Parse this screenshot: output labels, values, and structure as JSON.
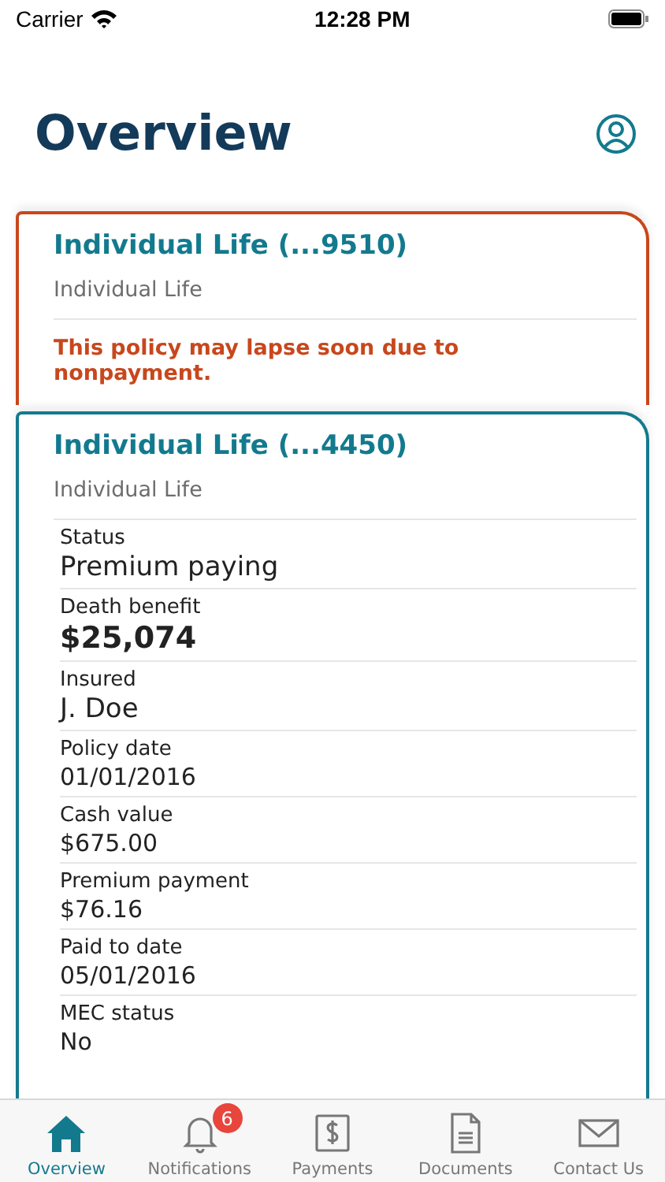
{
  "status_bar": {
    "carrier": "Carrier",
    "time": "12:28 PM"
  },
  "header": {
    "title": "Overview"
  },
  "policies": [
    {
      "title": "Individual Life (...9510)",
      "subtitle": "Individual Life",
      "alert": true,
      "warning": "This policy may lapse soon due to nonpayment."
    },
    {
      "title": "Individual Life (...4450)",
      "subtitle": "Individual Life",
      "alert": false,
      "fields": [
        {
          "label": "Status",
          "value": "Premium paying",
          "kind": "large"
        },
        {
          "label": "Death benefit",
          "value": "$25,074",
          "kind": "bold"
        },
        {
          "label": "Insured",
          "value": "J. Doe",
          "kind": "large"
        },
        {
          "label": "Policy date",
          "value": "01/01/2016",
          "kind": "plain"
        },
        {
          "label": "Cash value",
          "value": "$675.00",
          "kind": "plain"
        },
        {
          "label": "Premium payment",
          "value": "$76.16",
          "kind": "plain"
        },
        {
          "label": "Paid to date",
          "value": "05/01/2016",
          "kind": "plain"
        },
        {
          "label": "MEC status",
          "value": "No",
          "kind": "plain"
        }
      ]
    }
  ],
  "tabs": [
    {
      "label": "Overview",
      "selected": true
    },
    {
      "label": "Notifications",
      "selected": false,
      "badge": "6"
    },
    {
      "label": "Payments",
      "selected": false
    },
    {
      "label": "Documents",
      "selected": false
    },
    {
      "label": "Contact Us",
      "selected": false
    }
  ]
}
